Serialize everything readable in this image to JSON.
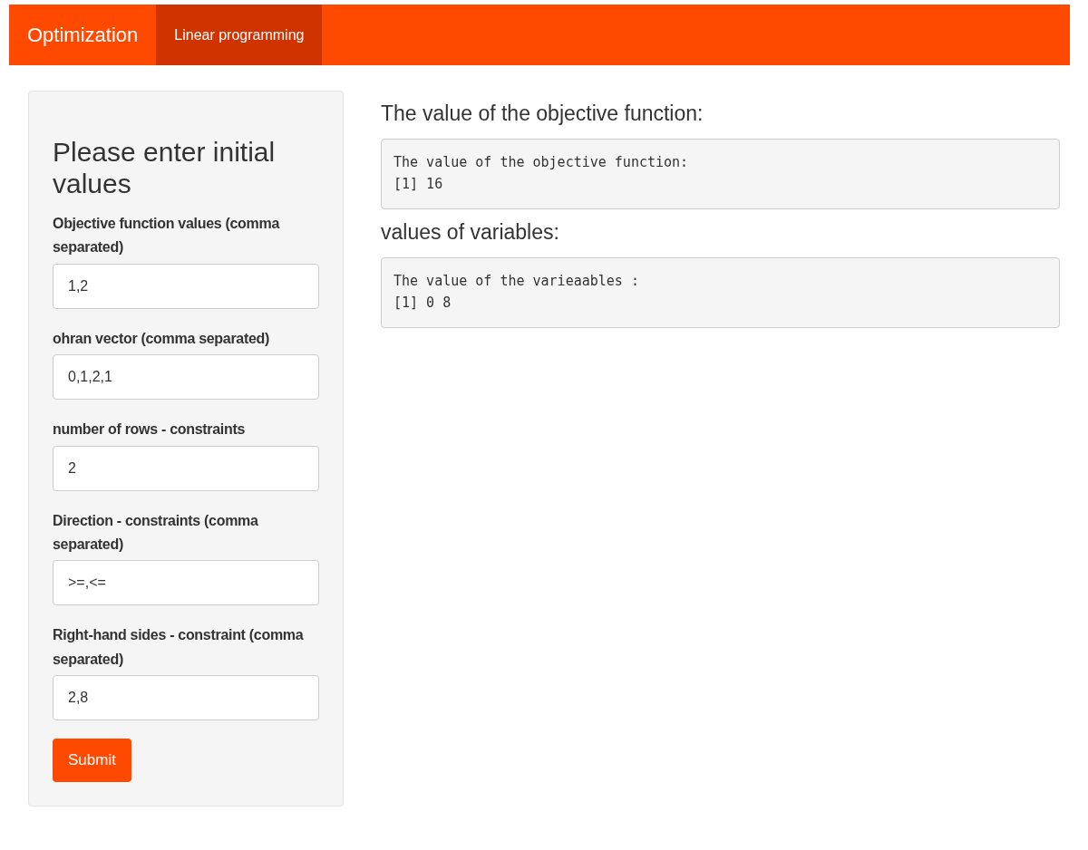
{
  "navbar": {
    "brand": "Optimization",
    "tabs": [
      {
        "label": "Linear programming",
        "selected": true
      }
    ]
  },
  "sidebar": {
    "title": "Please enter initial values",
    "fields": [
      {
        "label": "Objective function values (comma separated)",
        "value": "1,2"
      },
      {
        "label": "ohran vector (comma separated)",
        "value": "0,1,2,1"
      },
      {
        "label": "number of rows - constraints",
        "value": "2"
      },
      {
        "label": "Direction - constraints (comma separated)",
        "value": ">=,<="
      },
      {
        "label": "Right-hand sides - constraint (comma separated)",
        "value": "2,8"
      }
    ],
    "submit": "Submit"
  },
  "outputs": [
    {
      "heading": "The value of the objective function:",
      "lines": [
        "The value of the objective function:",
        "[1] 16"
      ]
    },
    {
      "heading": "values of variables:",
      "lines": [
        "The value of the varieaables :",
        "[1] 0 8"
      ]
    }
  ]
}
